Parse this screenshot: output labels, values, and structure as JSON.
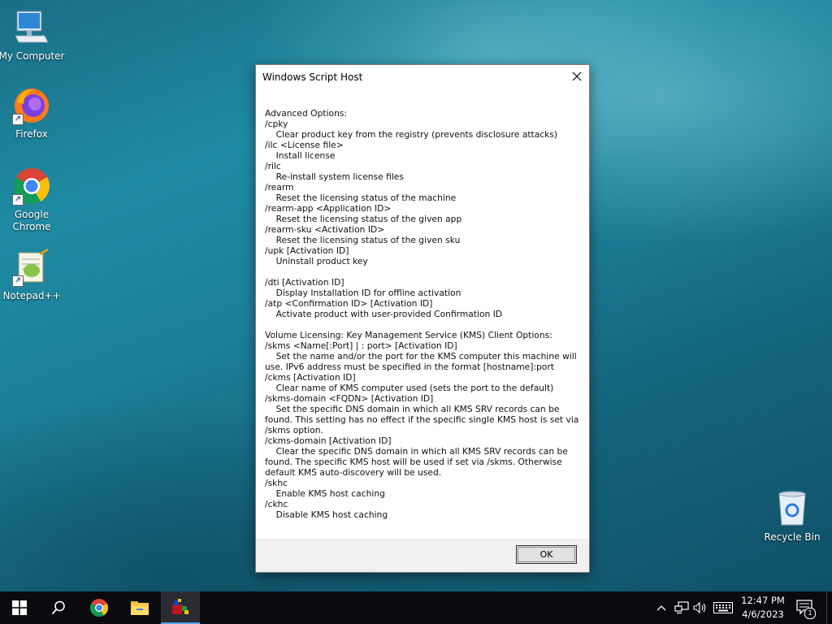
{
  "desktop": {
    "icons": [
      {
        "label": "My Computer"
      },
      {
        "label": "Firefox"
      },
      {
        "label": "Google Chrome"
      },
      {
        "label": "Notepad++"
      },
      {
        "label": "Recycle Bin"
      }
    ]
  },
  "dialog": {
    "title": "Windows Script Host",
    "body": "Advanced Options:\n/cpky\n    Clear product key from the registry (prevents disclosure attacks)\n/ilc <License file>\n    Install license\n/rilc\n    Re-install system license files\n/rearm\n    Reset the licensing status of the machine\n/rearm-app <Application ID>\n    Reset the licensing status of the given app\n/rearm-sku <Activation ID>\n    Reset the licensing status of the given sku\n/upk [Activation ID]\n    Uninstall product key\n\n/dti [Activation ID]\n    Display Installation ID for offline activation\n/atp <Confirmation ID> [Activation ID]\n    Activate product with user-provided Confirmation ID\n\nVolume Licensing: Key Management Service (KMS) Client Options:\n/skms <Name[:Port] | : port> [Activation ID]\n    Set the name and/or the port for the KMS computer this machine will use. IPv6 address must be specified in the format [hostname]:port\n/ckms [Activation ID]\n    Clear name of KMS computer used (sets the port to the default)\n/skms-domain <FQDN> [Activation ID]\n    Set the specific DNS domain in which all KMS SRV records can be found. This setting has no effect if the specific single KMS host is set via /skms option.\n/ckms-domain [Activation ID]\n    Clear the specific DNS domain in which all KMS SRV records can be found. The specific KMS host will be used if set via /skms. Otherwise default KMS auto-discovery will be used.\n/skhc\n    Enable KMS host caching\n/ckhc\n    Disable KMS host caching",
    "ok_label": "OK"
  },
  "taskbar": {
    "time": "12:47 PM",
    "date": "4/6/2023",
    "notification_count": "1",
    "accent_color": "#4ea1e6"
  },
  "icons": [
    "start-icon",
    "search-icon",
    "chrome-icon",
    "file-explorer-icon",
    "script-host-icon",
    "chevron-up-icon",
    "network-icon",
    "volume-icon",
    "keyboard-icon",
    "notification-icon"
  ]
}
